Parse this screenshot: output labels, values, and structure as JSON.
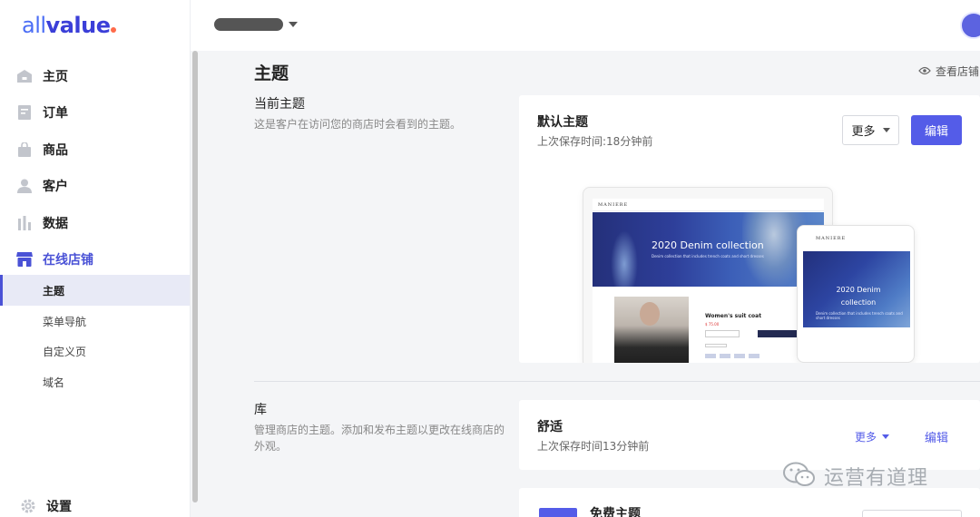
{
  "header": {
    "logo_all": "all",
    "logo_value": "value"
  },
  "sidebar": {
    "items": [
      {
        "label": "主页",
        "icon": "home-icon"
      },
      {
        "label": "订单",
        "icon": "order-icon"
      },
      {
        "label": "商品",
        "icon": "bag-icon"
      },
      {
        "label": "客户",
        "icon": "user-icon"
      },
      {
        "label": "数据",
        "icon": "bar-chart-icon"
      },
      {
        "label": "在线店铺",
        "icon": "store-icon"
      }
    ],
    "sub_items": [
      {
        "label": "主题"
      },
      {
        "label": "菜单导航"
      },
      {
        "label": "自定义页"
      },
      {
        "label": "域名"
      }
    ],
    "settings": {
      "label": "设置",
      "icon": "gear-icon"
    }
  },
  "main": {
    "title": "主题",
    "view_store": "查看店铺",
    "current": {
      "title": "当前主题",
      "desc": "这是客户在访问您的商店时会看到的主题。",
      "card_title": "默认主题",
      "saved": "上次保存时间:18分钟前",
      "more_label": "更多",
      "edit_label": "编辑"
    },
    "preview": {
      "brand": "MANIERE",
      "hero_text": "2020 Denim collection",
      "hero_small": "Denim collection that includes trench coats and short dresses",
      "product_name": "Women's suit coat",
      "price": "$ 75.00",
      "phone_hero_line1": "2020 Denim",
      "phone_hero_line2": "collection",
      "phone_hero_small": "Denim collection that includes trench coats and short dresses"
    },
    "library": {
      "title": "库",
      "desc_line1": "管理商店的主题。添加和发布主题以更改在线商店的",
      "desc_line2": "外观。",
      "card_title": "舒适",
      "saved": "上次保存时间13分钟前",
      "more_label": "更多",
      "edit_label": "编辑",
      "free_title": "免费主题"
    }
  },
  "watermark": {
    "text": "运营有道理"
  },
  "colors": {
    "accent": "#545ce8",
    "sidebar_active_bg": "#e8eaf6",
    "background": "#f4f5f7"
  }
}
